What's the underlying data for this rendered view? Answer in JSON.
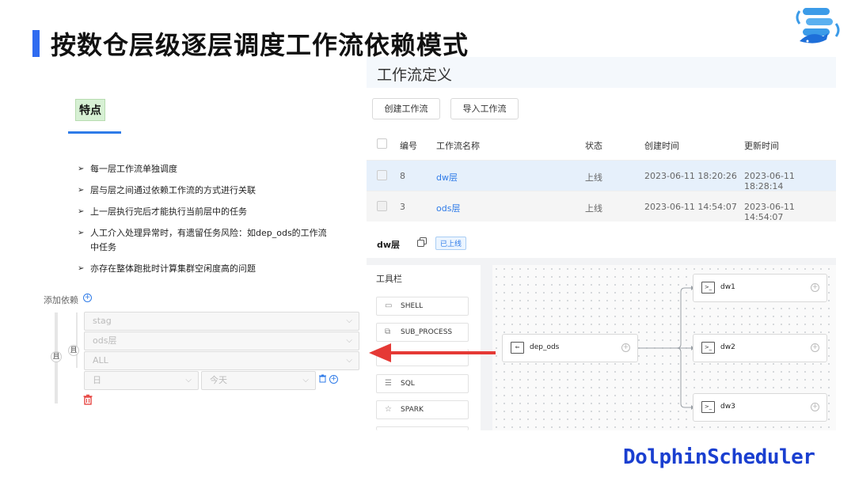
{
  "slide": {
    "title": "按数仓层级逐层调度工作流依赖模式",
    "brand": "DolphinScheduler",
    "accent_color": "#2f6bf0"
  },
  "features": {
    "tag": "特点",
    "bullets": [
      "每一层工作流单独调度",
      "层与层之间通过依赖工作流的方式进行关联",
      "上一层执行完后才能执行当前层中的任务",
      "人工介入处理异常时，有遗留任务风险：如dep_ods的工作流中任务",
      "亦存在整体跑批时计算集群空闲度高的问题"
    ],
    "bullet_marker": "➢"
  },
  "dependency": {
    "add_label": "添加依赖",
    "and_label": "且",
    "selects": {
      "project": "stag",
      "workflow": "ods层",
      "task": "ALL",
      "cycle": "日",
      "date": "今天"
    }
  },
  "workflow_definition": {
    "title": "工作流定义",
    "create_button": "创建工作流",
    "import_button": "导入工作流",
    "columns": [
      "编号",
      "工作流名称",
      "状态",
      "创建时间",
      "更新时间"
    ],
    "rows": [
      {
        "no": "8",
        "name": "dw层",
        "state": "上线",
        "created": "2023-06-11 18:20:26",
        "updated": "2023-06-11 18:28:14"
      },
      {
        "no": "3",
        "name": "ods层",
        "state": "上线",
        "created": "2023-06-11 14:54:07",
        "updated": "2023-06-11 14:54:07"
      }
    ]
  },
  "dag": {
    "name": "dw层",
    "status_tag": "已上线",
    "toolbox_title": "工具栏",
    "tools": [
      {
        "label": "SHELL",
        "icon": "terminal-icon"
      },
      {
        "label": "SUB_PROCESS",
        "icon": "subprocess-icon"
      },
      {
        "label": "SQL",
        "icon": "sql-icon"
      },
      {
        "label": "SPARK",
        "icon": "spark-icon"
      }
    ],
    "nodes": {
      "source": "dep_ods",
      "targets": [
        "dw1",
        "dw2",
        "dw3"
      ]
    },
    "annotation_arrow_color": "#e53935"
  }
}
